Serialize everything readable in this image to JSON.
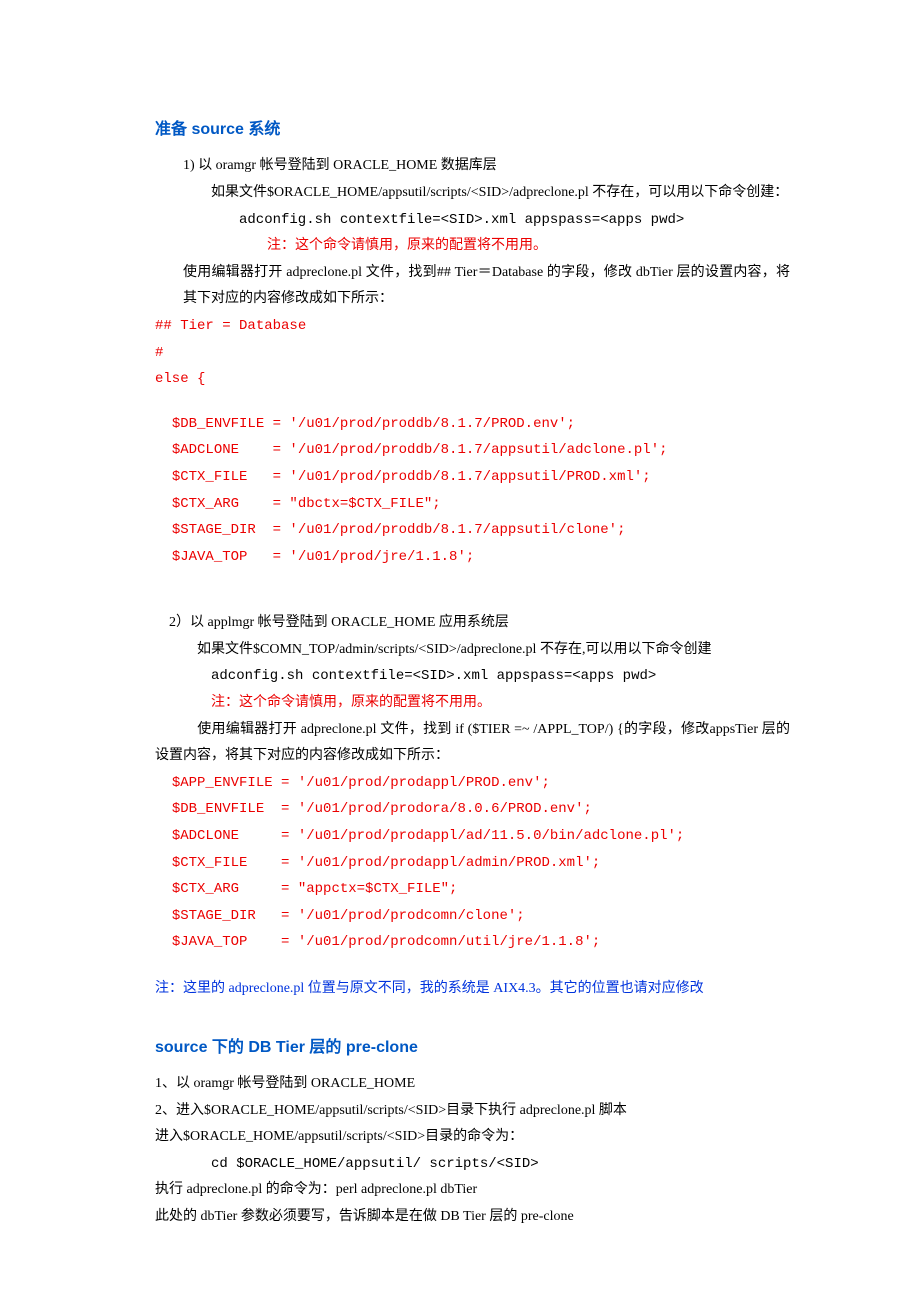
{
  "section1": {
    "heading": "准备 source 系统",
    "l1": "1)  以 oramgr 帐号登陆到 ORACLE_HOME 数据库层",
    "l2": "如果文件$ORACLE_HOME/appsutil/scripts/<SID>/adpreclone.pl 不存在，可以用以下命令创建：",
    "l3": "adconfig.sh contextfile=<SID>.xml appspass=<apps pwd>",
    "l4": "注：这个命令请慎用，原来的配置将不用用。",
    "l5": "使用编辑器打开 adpreclone.pl 文件，找到## Tier＝Database 的字段，修改 dbTier 层的设置内容，将其下对应的内容修改成如下所示：",
    "code1": {
      "a": "## Tier = Database",
      "b": "#",
      "c": "else {",
      "d": "  $DB_ENVFILE = '/u01/prod/proddb/8.1.7/PROD.env';",
      "e": "  $ADCLONE    = '/u01/prod/proddb/8.1.7/appsutil/adclone.pl';",
      "f": "  $CTX_FILE   = '/u01/prod/proddb/8.1.7/appsutil/PROD.xml';",
      "g": "  $CTX_ARG    = \"dbctx=$CTX_FILE\";",
      "h": "  $STAGE_DIR  = '/u01/prod/proddb/8.1.7/appsutil/clone';",
      "i": "  $JAVA_TOP   = '/u01/prod/jre/1.1.8';"
    },
    "l6": "2）以 applmgr 帐号登陆到 ORACLE_HOME 应用系统层",
    "l7": "如果文件$COMN_TOP/admin/scripts/<SID>/adpreclone.pl 不存在,可以用以下命令创建",
    "l8": "adconfig.sh contextfile=<SID>.xml appspass=<apps pwd>",
    "l9": "注：这个命令请慎用，原来的配置将不用用。",
    "l10": "使用编辑器打开 adpreclone.pl 文件，找到 if ($TIER =~ /APPL_TOP/) {的字段，修改appsTier 层的设置内容，将其下对应的内容修改成如下所示：",
    "code2": {
      "a": "  $APP_ENVFILE = '/u01/prod/prodappl/PROD.env';",
      "b": "  $DB_ENVFILE  = '/u01/prod/prodora/8.0.6/PROD.env';",
      "c": "  $ADCLONE     = '/u01/prod/prodappl/ad/11.5.0/bin/adclone.pl';",
      "d": "  $CTX_FILE    = '/u01/prod/prodappl/admin/PROD.xml';",
      "e": "  $CTX_ARG     = \"appctx=$CTX_FILE\";",
      "f": "  $STAGE_DIR   = '/u01/prod/prodcomn/clone';",
      "g": "  $JAVA_TOP    = '/u01/prod/prodcomn/util/jre/1.1.8';"
    },
    "note": "注：这里的 adpreclone.pl 位置与原文不同，我的系统是 AIX4.3。其它的位置也请对应修改"
  },
  "section2": {
    "heading": "source 下的 DB Tier 层的 pre-clone",
    "l1": "1、以 oramgr 帐号登陆到 ORACLE_HOME",
    "l2": "2、进入$ORACLE_HOME/appsutil/scripts/<SID>目录下执行 adpreclone.pl 脚本",
    "l3": "进入$ORACLE_HOME/appsutil/scripts/<SID>目录的命令为：",
    "l4": "cd $ORACLE_HOME/appsutil/ scripts/<SID>",
    "l5": "执行 adpreclone.pl 的命令为：perl adpreclone.pl dbTier",
    "l6": "此处的 dbTier 参数必须要写，告诉脚本是在做 DB Tier 层的 pre-clone"
  }
}
